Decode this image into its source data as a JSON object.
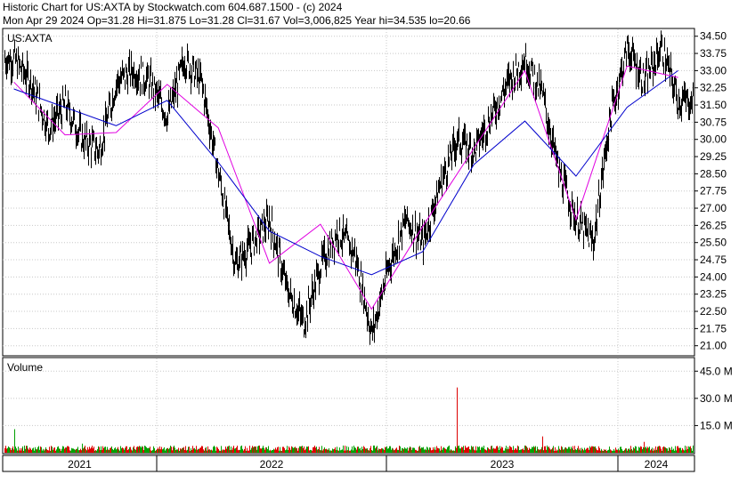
{
  "header": {
    "line1": "Historic Chart for US:AXTA by Stockwatch.com 604.687.1500 - (c) 2024",
    "line2": "Mon Apr 29 2024   Op=31.28   Hi=31.875   Lo=31.28   Cl=31.67   Vol=3,006,825   Year hi=34.535   lo=20.66"
  },
  "price_panel": {
    "symbol": "US:AXTA"
  },
  "volume_panel": {
    "title": "Volume"
  },
  "colors": {
    "price_bar": "#000000",
    "ma_short": "#e000e0",
    "ma_long": "#0000cc",
    "volume_up": "#00a000",
    "volume_down": "#dd0000",
    "grid": "#c8c8c8"
  },
  "chart_data": [
    {
      "type": "line",
      "title": "US:AXTA",
      "ylim": [
        20.6,
        34.8
      ],
      "y_ticks": [
        "34.50",
        "33.75",
        "33.00",
        "32.25",
        "31.50",
        "30.75",
        "30.00",
        "29.25",
        "28.50",
        "27.75",
        "27.00",
        "26.25",
        "25.50",
        "24.75",
        "24.00",
        "23.25",
        "22.50",
        "21.75",
        "21.00"
      ],
      "x_ticks": [
        "2021",
        "2022",
        "2023",
        "2024"
      ],
      "grid": true,
      "series": [
        {
          "style": "high-low bars",
          "x": [
            "2021-01",
            "2021-02",
            "2021-03",
            "2021-04",
            "2021-05",
            "2021-06",
            "2021-07",
            "2021-08",
            "2021-09",
            "2021-10",
            "2021-11",
            "2021-12",
            "2022-01",
            "2022-02",
            "2022-03",
            "2022-04",
            "2022-05",
            "2022-06",
            "2022-07",
            "2022-08",
            "2022-09",
            "2022-10",
            "2022-11",
            "2022-12",
            "2023-01",
            "2023-02",
            "2023-03",
            "2023-04",
            "2023-05",
            "2023-06",
            "2023-07",
            "2023-08",
            "2023-09",
            "2023-10",
            "2023-11",
            "2023-12",
            "2024-01",
            "2024-02",
            "2024-03",
            "2024-04"
          ],
          "values": [
            33.5,
            32.5,
            30.5,
            31.5,
            30.0,
            29.5,
            32.5,
            33.0,
            32.5,
            31.0,
            33.5,
            32.5,
            28.5,
            24.5,
            25.5,
            26.5,
            23.5,
            22.0,
            24.5,
            26.0,
            25.0,
            21.5,
            24.5,
            26.5,
            25.5,
            28.0,
            30.0,
            29.5,
            31.0,
            32.5,
            33.5,
            32.0,
            28.5,
            26.5,
            25.5,
            31.0,
            34.0,
            32.5,
            34.0,
            31.67
          ]
        },
        {
          "style": "short moving average",
          "x": [
            "2021-01",
            "2021-04",
            "2021-07",
            "2021-10",
            "2022-01",
            "2022-04",
            "2022-07",
            "2022-10",
            "2023-01",
            "2023-04",
            "2023-07",
            "2023-10",
            "2024-01",
            "2024-04"
          ],
          "values": [
            32.5,
            30.2,
            30.3,
            32.4,
            30.5,
            24.6,
            26.3,
            22.6,
            26.2,
            29.6,
            33.0,
            26.5,
            33.2,
            32.7
          ]
        },
        {
          "style": "long moving average",
          "x": [
            "2021-01",
            "2021-07",
            "2021-10",
            "2022-01",
            "2022-04",
            "2022-07",
            "2022-10",
            "2023-01",
            "2023-04",
            "2023-07",
            "2023-10",
            "2024-01",
            "2024-04"
          ],
          "values": [
            32.2,
            30.6,
            31.7,
            29.0,
            26.0,
            24.9,
            24.1,
            25.1,
            28.9,
            30.8,
            28.4,
            31.4,
            33.0
          ]
        }
      ]
    },
    {
      "type": "bar",
      "title": "Volume",
      "ylim": [
        0,
        52
      ],
      "y_ticks": [
        "45.0 M",
        "30.0 M",
        "15.0 M"
      ],
      "x_ticks": [
        "2021",
        "2022",
        "2023",
        "2024"
      ],
      "grid": true,
      "baseline_millions": 2.5,
      "spikes": [
        {
          "x": "2021-01",
          "millions": 13,
          "direction": "up"
        },
        {
          "x": "2021-05",
          "millions": 5,
          "direction": "up"
        },
        {
          "x": "2023-03",
          "millions": 36,
          "direction": "down"
        },
        {
          "x": "2023-08",
          "millions": 9,
          "direction": "down"
        },
        {
          "x": "2024-02",
          "millions": 6,
          "direction": "down"
        }
      ]
    }
  ]
}
